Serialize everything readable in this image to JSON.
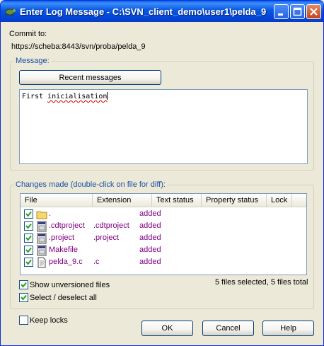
{
  "window": {
    "title": "Enter Log Message - C:\\SVN_client_demo\\user1\\pelda_9"
  },
  "commit": {
    "label": "Commit to:",
    "url": "https://scheba:8443/svn/proba/pelda_9"
  },
  "message": {
    "group_label": "Message:",
    "recent_button": "Recent messages",
    "text_word1": "First ",
    "text_word2": "inicialisation"
  },
  "changes": {
    "group_label": "Changes made (double-click on file for diff):",
    "columns": [
      "File",
      "Extension",
      "Text status",
      "Property status",
      "Lock"
    ],
    "rows": [
      {
        "file": ".",
        "extension": "",
        "text_status": "added",
        "checked": true,
        "icon": "folder-icon"
      },
      {
        "file": ".cdtproject",
        "extension": ".cdtproject",
        "text_status": "added",
        "checked": true,
        "icon": "file-icon"
      },
      {
        "file": ".project",
        "extension": ".project",
        "text_status": "added",
        "checked": true,
        "icon": "file-icon"
      },
      {
        "file": "Makefile",
        "extension": "",
        "text_status": "added",
        "checked": true,
        "icon": "file-icon"
      },
      {
        "file": "pelda_9.c",
        "extension": ".c",
        "text_status": "added",
        "checked": true,
        "icon": "text-file-icon"
      }
    ],
    "show_unversioned": "Show unversioned files",
    "select_all": "Select / deselect all",
    "summary": "5 files selected, 5 files total"
  },
  "keep_locks": "Keep locks",
  "buttons": {
    "ok": "OK",
    "cancel": "Cancel",
    "help": "Help"
  }
}
